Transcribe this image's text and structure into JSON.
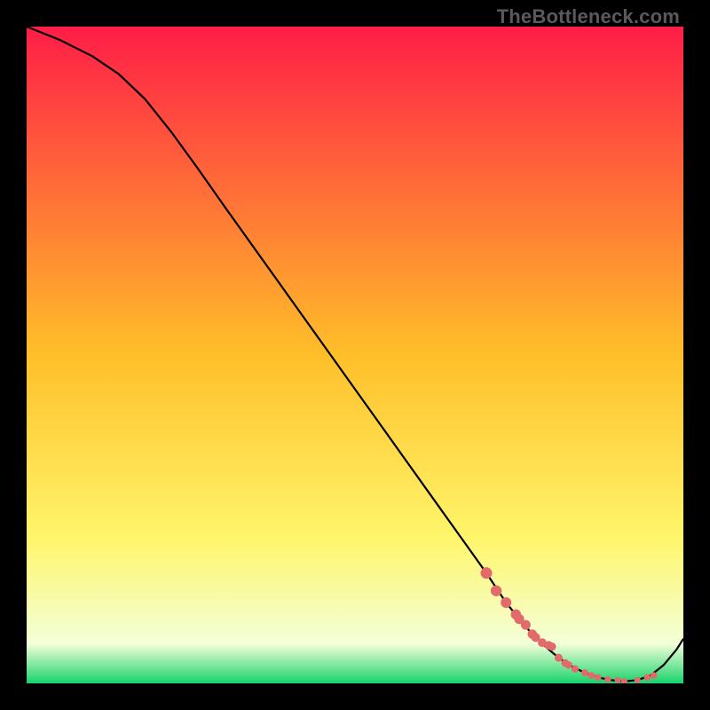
{
  "watermark": "TheBottleneck.com",
  "chart_data": {
    "type": "line",
    "title": "",
    "xlabel": "",
    "ylabel": "",
    "xlim": [
      0,
      100
    ],
    "ylim": [
      0,
      100
    ],
    "grid": false,
    "legend": false,
    "background_gradient": {
      "stops": [
        {
          "pos": 0.0,
          "color": "#ff1d47"
        },
        {
          "pos": 0.5,
          "color": "#ffbf29"
        },
        {
          "pos": 0.78,
          "color": "#fff66c"
        },
        {
          "pos": 0.94,
          "color": "#f3ffd8"
        },
        {
          "pos": 1.0,
          "color": "#17d36a"
        }
      ]
    },
    "series": [
      {
        "name": "bottleneck-curve",
        "color": "#000000",
        "x": [
          0,
          5,
          10,
          14,
          18,
          22,
          26,
          30,
          34,
          38,
          42,
          46,
          50,
          54,
          58,
          62,
          66,
          70,
          73,
          75,
          77,
          79,
          81,
          83,
          85,
          87,
          89,
          91,
          93,
          95,
          97,
          99,
          100
        ],
        "y": [
          100,
          98,
          95.5,
          92.8,
          89,
          84,
          78.5,
          72.8,
          67.2,
          61.6,
          56,
          50.4,
          44.8,
          39.2,
          33.6,
          28,
          22.4,
          16.8,
          12.3,
          9.8,
          7.5,
          5.6,
          3.9,
          2.6,
          1.6,
          0.9,
          0.5,
          0.3,
          0.5,
          1.2,
          2.8,
          5.2,
          6.8
        ]
      }
    ],
    "points": {
      "name": "bottleneck-markers",
      "color": "#e36a6a",
      "radius_min": 3.5,
      "radius_max": 6.5,
      "x": [
        70,
        71.5,
        73,
        74.5,
        75,
        76,
        77,
        77.5,
        78.5,
        79.5,
        80,
        81,
        82,
        82.5,
        83.5,
        85,
        86,
        87,
        88.5,
        90,
        91,
        93,
        94.5,
        95.5
      ],
      "y": [
        16.8,
        14.1,
        12.3,
        10.5,
        9.8,
        8.9,
        7.5,
        7.0,
        6.2,
        5.8,
        5.6,
        3.9,
        3.1,
        2.8,
        2.2,
        1.6,
        1.2,
        0.9,
        0.6,
        0.5,
        0.3,
        0.5,
        0.9,
        1.2
      ],
      "r": [
        6.5,
        6.2,
        6.0,
        5.8,
        5.6,
        5.5,
        5.3,
        5.1,
        4.9,
        4.8,
        4.6,
        4.5,
        4.3,
        4.2,
        4.1,
        4.0,
        3.9,
        3.8,
        3.7,
        3.6,
        3.6,
        3.6,
        3.7,
        3.8
      ]
    }
  }
}
